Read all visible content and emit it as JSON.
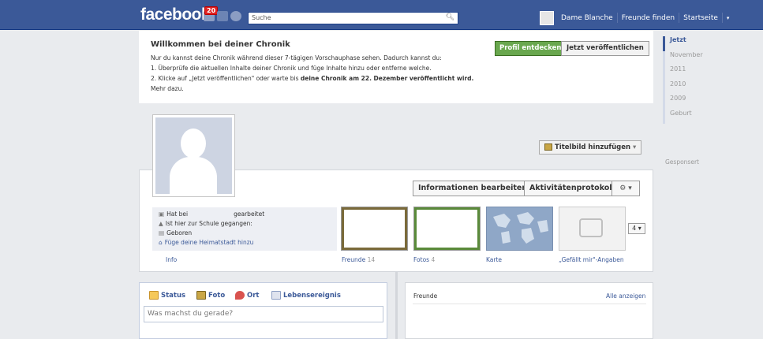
{
  "topbar": {
    "logo": "facebook",
    "notification_count": "20",
    "search_placeholder": "Suche",
    "user_name": "Dame Blanche",
    "find_friends": "Freunde finden",
    "home": "Startseite",
    "menu_caret": "▾"
  },
  "welcome": {
    "title": "Willkommen bei deiner Chronik",
    "line1": "Nur du kannst deine Chronik während dieser 7-tägigen Vorschauphase sehen. Dadurch kannst du:",
    "line2": "1. Überprüfe die aktuellen Inhalte deiner Chronik und füge Inhalte hinzu oder entferne welche.",
    "line3_prefix": "2. Klicke auf „Jetzt veröffentlichen\" oder warte bis ",
    "line3_bold": "deine Chronik am 22. Dezember veröffentlicht wird.",
    "more": "Mehr dazu.",
    "discover_button": "Profil entdecken",
    "publish_button": "Jetzt veröffentlichen"
  },
  "timeline_nav": [
    "Jetzt",
    "November",
    "2011",
    "2010",
    "2009",
    "Geburt"
  ],
  "sponsored": "Gesponsert",
  "profile": {
    "add_cover_button": "Titelbild hinzufügen",
    "edit_info_button": "Informationen bearbeiten",
    "activity_log_button": "Aktivitätenprotokoll",
    "info": {
      "worked_at_prefix": "Hat bei",
      "worked_at_suffix": "gearbeitet",
      "school": "Ist hier zur Schule gegangen:",
      "born": "Geboren",
      "add_hometown": "Füge deine Heimatstadt hinzu",
      "label": "Info"
    },
    "friends_label": "Freunde",
    "friends_count": "14",
    "photos_label": "Fotos",
    "photos_count": "4",
    "map_label": "Karte",
    "likes_label": "„Gefällt mir\"-Angaben",
    "more_count": "4"
  },
  "composer": {
    "tabs": [
      "Status",
      "Foto",
      "Ort",
      "Lebensereignis"
    ],
    "placeholder": "Was machst du gerade?"
  },
  "friends_box": {
    "title": "Freunde",
    "see_all": "Alle anzeigen"
  }
}
